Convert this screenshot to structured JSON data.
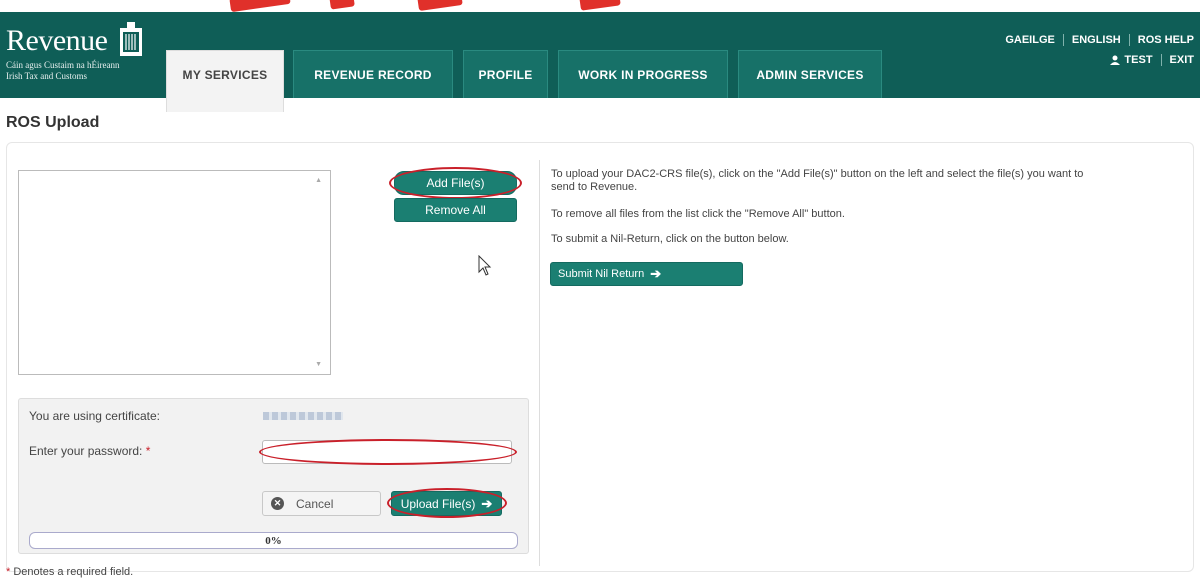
{
  "branding": {
    "logo_word": "Revenue",
    "logo_sub1": "Cáin agus Custaim na hÉireann",
    "logo_sub2": "Irish Tax and Customs"
  },
  "nav": {
    "tabs": [
      {
        "label": "MY SERVICES"
      },
      {
        "label": "REVENUE RECORD"
      },
      {
        "label": "PROFILE"
      },
      {
        "label": "WORK IN PROGRESS"
      },
      {
        "label": "ADMIN SERVICES"
      }
    ],
    "active": "MY SERVICES"
  },
  "top_links": {
    "gaeilge": "GAEILGE",
    "english": "ENGLISH",
    "ros_help": "ROS HELP",
    "user": "TEST",
    "exit": "EXIT"
  },
  "page": {
    "title": "ROS Upload"
  },
  "file_panel": {
    "add_button": "Add File(s)",
    "remove_all_button": "Remove All"
  },
  "instructions": {
    "line1": "To upload your DAC2-CRS file(s), click on the \"Add File(s)\" button on the left and select the file(s) you want to",
    "line1b": "send to Revenue.",
    "line2": "To remove all files from the list click the \"Remove All\" button.",
    "line3": "To submit a Nil-Return, click on the button below.",
    "submit_nil": "Submit Nil Return"
  },
  "certificate": {
    "cert_label": "You are using certificate:",
    "password_label": "Enter your password:",
    "required_mark": "*",
    "cancel_button": "Cancel",
    "upload_button": "Upload File(s)"
  },
  "progress": {
    "value": 0,
    "text": "0%"
  },
  "footer": {
    "required_note": "Denotes a required field."
  },
  "colors": {
    "header": "#0f5e57",
    "button": "#1b7f72",
    "highlight": "#c9202a"
  }
}
